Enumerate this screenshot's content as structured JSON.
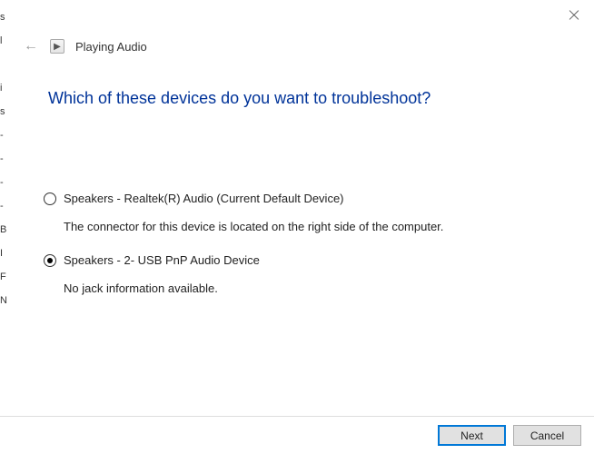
{
  "header": {
    "title": "Playing Audio"
  },
  "main": {
    "heading": "Which of these devices do you want to troubleshoot?"
  },
  "devices": [
    {
      "label": "Speakers - Realtek(R) Audio (Current Default Device)",
      "description": "The connector for this device is located on the right side of the computer.",
      "selected": false
    },
    {
      "label": "Speakers - 2- USB PnP Audio Device",
      "description": "No jack information available.",
      "selected": true
    }
  ],
  "footer": {
    "next": "Next",
    "cancel": "Cancel"
  },
  "left_edge_chars": [
    "s",
    "l",
    "",
    "i",
    "s",
    "-",
    "-",
    "-",
    "-",
    "B",
    "I",
    "F",
    "N"
  ]
}
